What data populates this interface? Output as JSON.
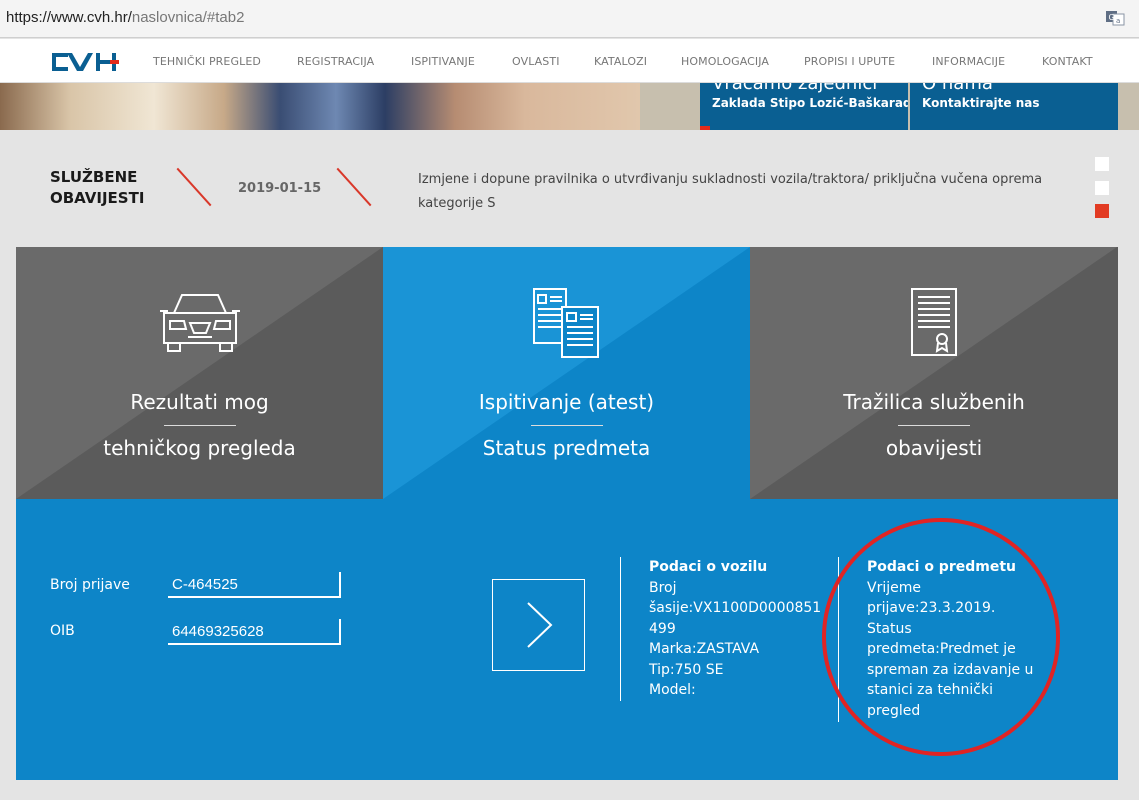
{
  "browser": {
    "url_host": "https://www.cvh.hr/",
    "url_path": "naslovnica/#tab2"
  },
  "nav": {
    "logo_text": "CVH",
    "items": [
      "TEHNIČKI PREGLED",
      "REGISTRACIJA",
      "ISPITIVANJE",
      "OVLASTI",
      "KATALOZI",
      "HOMOLOGACIJA",
      "PROPISI I UPUTE",
      "INFORMACIJE",
      "KONTAKT"
    ]
  },
  "hero": {
    "card1_big": "Vraćamo zajednici",
    "card1_small": "Zaklada Stipo Lozić-Baškarad",
    "card2_big": "O nama",
    "card2_small": "Kontaktirajte nas"
  },
  "notices": {
    "title_line1": "SLUŽBENE",
    "title_line2": "OBAVIJESTI",
    "date": "2019-01-15",
    "text": "Izmjene i dopune pravilnika o utvrđivanju sukladnosti vozila/traktora/ priključna vučena oprema kategorije S"
  },
  "tiles": [
    {
      "line1": "Rezultati mog",
      "line2": "tehničkog pregleda",
      "icon": "car-icon"
    },
    {
      "line1": "Ispitivanje (atest)",
      "line2": "Status predmeta",
      "icon": "documents-icon"
    },
    {
      "line1": "Tražilica službenih",
      "line2": "obavijesti",
      "icon": "certificate-icon"
    }
  ],
  "form": {
    "broj_label": "Broj prijave",
    "broj_value": "C-464525",
    "oib_label": "OIB",
    "oib_value": "64469325628"
  },
  "vehicle": {
    "heading": "Podaci o vozilu",
    "lines": [
      "Broj",
      "šasije:VX1100D0000851",
      "499",
      "Marka:ZASTAVA",
      "Tip:750 SE",
      "Model:"
    ]
  },
  "subject": {
    "heading": "Podaci o predmetu",
    "lines": [
      "Vrijeme",
      "prijave:23.3.2019.",
      "Status",
      "predmeta:Predmet je",
      "spreman za izdavanje u",
      "stanici za tehnički",
      "pregled"
    ]
  },
  "colors": {
    "brand_blue": "#0d85c8",
    "dark_blue": "#0a5f92",
    "tile_gray": "#5b5b5b",
    "accent_red": "#e23b23",
    "highlight_circle": "#e02424"
  }
}
